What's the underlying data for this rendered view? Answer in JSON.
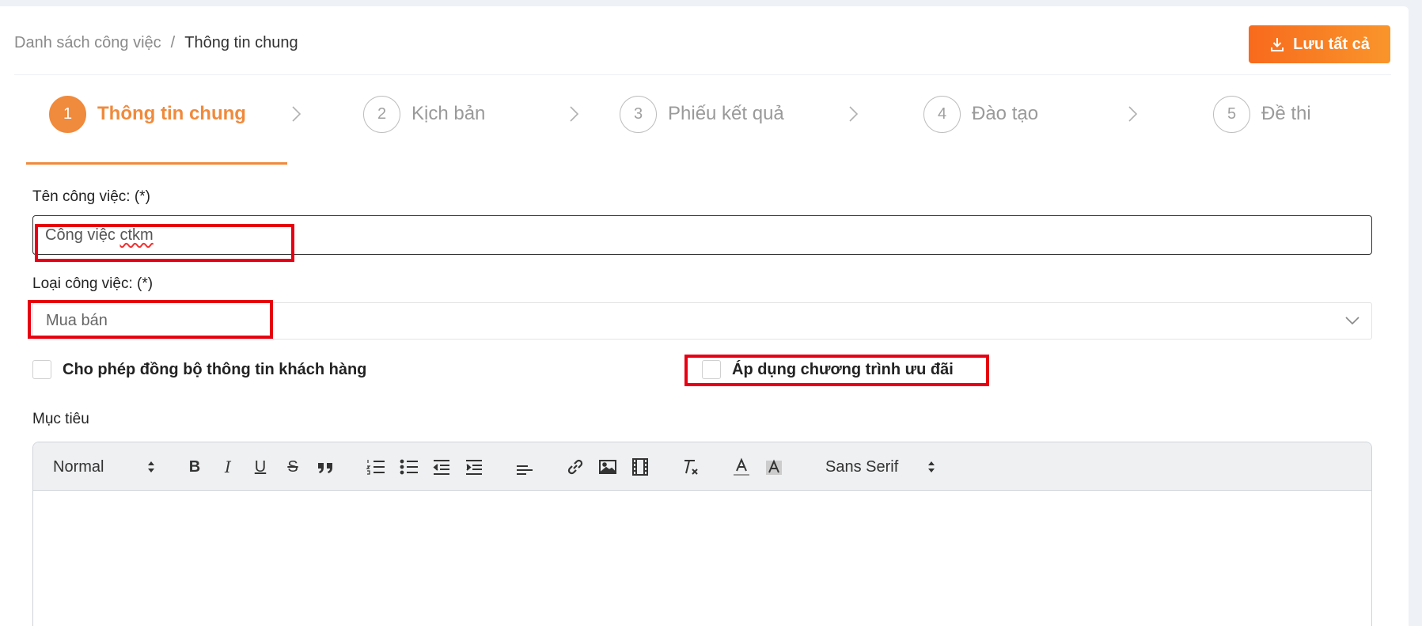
{
  "breadcrumb": {
    "parent": "Danh sách công việc",
    "separator": "/",
    "current": "Thông tin chung"
  },
  "save_button": {
    "label": "Lưu tất cả"
  },
  "steps": [
    {
      "num": "1",
      "label": "Thông tin chung",
      "active": true
    },
    {
      "num": "2",
      "label": "Kịch bản",
      "active": false
    },
    {
      "num": "3",
      "label": "Phiếu kết quả",
      "active": false
    },
    {
      "num": "4",
      "label": "Đào tạo",
      "active": false
    },
    {
      "num": "5",
      "label": "Đề thi",
      "active": false
    }
  ],
  "form": {
    "name_label": "Tên công việc: (*)",
    "name_value_prefix": "Công việc ",
    "name_value_misspelled": "ctkm",
    "type_label": "Loại công việc: (*)",
    "type_value": "Mua bán",
    "sync_checkbox_label": "Cho phép đồng bộ thông tin khách hàng",
    "promo_checkbox_label": "Áp dụng chương trình ưu đãi",
    "goal_label": "Mục tiêu"
  },
  "editor_toolbar": {
    "heading_select": "Normal",
    "font_select": "Sans Serif"
  },
  "colors": {
    "accent": "#f08a3c",
    "highlight": "#e60012"
  }
}
